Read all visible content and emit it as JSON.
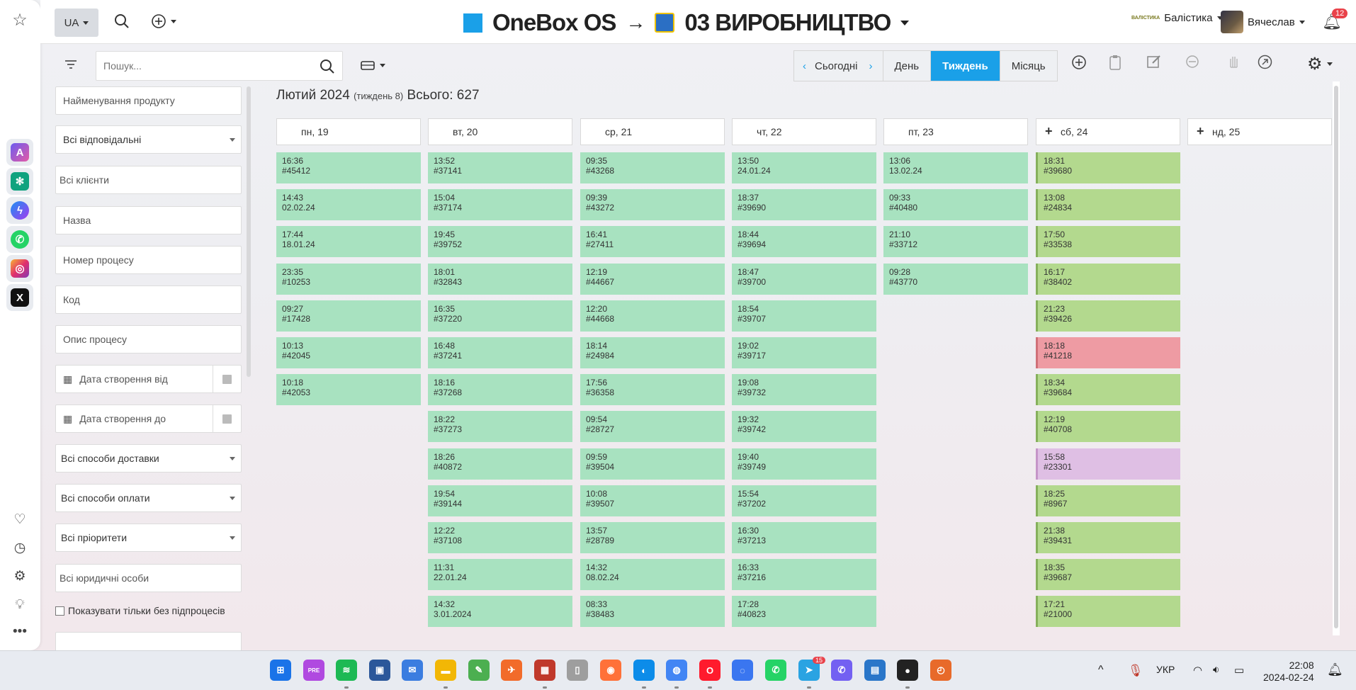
{
  "header": {
    "lang": "UA",
    "brand": "OneBox OS",
    "arrow": "→",
    "project": "03 ВИРОБНИЦТВО",
    "company": "Балістика",
    "company_logo_text": "ВАЛІСТИКА",
    "user": "Вячеслав",
    "notifications": "12"
  },
  "toolbar": {
    "search_placeholder": "Пошук...",
    "nav": {
      "prev": "‹",
      "today": "Сьогодні",
      "next": "›",
      "day": "День",
      "week": "Тиждень",
      "month": "Місяць"
    }
  },
  "filters": {
    "product_name": "Найменування продукту",
    "responsible": "Всі відповідальні",
    "clients": "Всі клієнти",
    "name": "Назва",
    "process_number": "Номер процесу",
    "code": "Код",
    "process_desc": "Опис процесу",
    "date_from": "Дата створення від",
    "date_to": "Дата створення до",
    "delivery": "Всі способи доставки",
    "payment": "Всі способи оплати",
    "priorities": "Всі пріоритети",
    "legal_entities": "Всі юридичні особи",
    "no_subprocess": "Показувати тільки без підпроцесів"
  },
  "calendar": {
    "month": "Лютий 2024",
    "week_label": "(тиждень 8)",
    "total": "Всього: 627",
    "days": [
      {
        "label": "пн, 19",
        "plus": false,
        "events": [
          {
            "t": "16:36",
            "n": "#45412",
            "c": "green"
          },
          {
            "t": "14:43",
            "n": "02.02.24",
            "c": "green"
          },
          {
            "t": "17:44",
            "n": "18.01.24",
            "c": "green"
          },
          {
            "t": "23:35",
            "n": "#10253",
            "c": "green"
          },
          {
            "t": "09:27",
            "n": "#17428",
            "c": "green"
          },
          {
            "t": "10:13",
            "n": "#42045",
            "c": "green"
          },
          {
            "t": "10:18",
            "n": "#42053",
            "c": "green"
          }
        ]
      },
      {
        "label": "вт, 20",
        "plus": false,
        "events": [
          {
            "t": "13:52",
            "n": "#37141",
            "c": "green"
          },
          {
            "t": "15:04",
            "n": "#37174",
            "c": "green"
          },
          {
            "t": "19:45",
            "n": "#39752",
            "c": "green"
          },
          {
            "t": "18:01",
            "n": "#32843",
            "c": "green"
          },
          {
            "t": "16:35",
            "n": "#37220",
            "c": "green"
          },
          {
            "t": "16:48",
            "n": "#37241",
            "c": "green"
          },
          {
            "t": "18:16",
            "n": "#37268",
            "c": "green"
          },
          {
            "t": "18:22",
            "n": "#37273",
            "c": "green"
          },
          {
            "t": "18:26",
            "n": "#40872",
            "c": "green"
          },
          {
            "t": "19:54",
            "n": "#39144",
            "c": "green"
          },
          {
            "t": "12:22",
            "n": "#37108",
            "c": "green"
          },
          {
            "t": "11:31",
            "n": "22.01.24",
            "c": "green"
          },
          {
            "t": "14:32",
            "n": "3.01.2024",
            "c": "green"
          }
        ]
      },
      {
        "label": "ср, 21",
        "plus": false,
        "events": [
          {
            "t": "09:35",
            "n": "#43268",
            "c": "green"
          },
          {
            "t": "09:39",
            "n": "#43272",
            "c": "green"
          },
          {
            "t": "16:41",
            "n": "#27411",
            "c": "green"
          },
          {
            "t": "12:19",
            "n": "#44667",
            "c": "green"
          },
          {
            "t": "12:20",
            "n": "#44668",
            "c": "green"
          },
          {
            "t": "18:14",
            "n": "#24984",
            "c": "green"
          },
          {
            "t": "17:56",
            "n": "#36358",
            "c": "green"
          },
          {
            "t": "09:54",
            "n": "#28727",
            "c": "green"
          },
          {
            "t": "09:59",
            "n": "#39504",
            "c": "green"
          },
          {
            "t": "10:08",
            "n": "#39507",
            "c": "green"
          },
          {
            "t": "13:57",
            "n": "#28789",
            "c": "green"
          },
          {
            "t": "14:32",
            "n": "08.02.24",
            "c": "green"
          },
          {
            "t": "08:33",
            "n": "#38483",
            "c": "green"
          }
        ]
      },
      {
        "label": "чт, 22",
        "plus": false,
        "events": [
          {
            "t": "13:50",
            "n": "24.01.24",
            "c": "green"
          },
          {
            "t": "18:37",
            "n": "#39690",
            "c": "green"
          },
          {
            "t": "18:44",
            "n": "#39694",
            "c": "green"
          },
          {
            "t": "18:47",
            "n": "#39700",
            "c": "green"
          },
          {
            "t": "18:54",
            "n": "#39707",
            "c": "green"
          },
          {
            "t": "19:02",
            "n": "#39717",
            "c": "green"
          },
          {
            "t": "19:08",
            "n": "#39732",
            "c": "green"
          },
          {
            "t": "19:32",
            "n": "#39742",
            "c": "green"
          },
          {
            "t": "19:40",
            "n": "#39749",
            "c": "green"
          },
          {
            "t": "15:54",
            "n": "#37202",
            "c": "green"
          },
          {
            "t": "16:30",
            "n": "#37213",
            "c": "green"
          },
          {
            "t": "16:33",
            "n": "#37216",
            "c": "green"
          },
          {
            "t": "17:28",
            "n": "#40823",
            "c": "green"
          }
        ]
      },
      {
        "label": "пт, 23",
        "plus": false,
        "events": [
          {
            "t": "13:06",
            "n": "13.02.24",
            "c": "green"
          },
          {
            "t": "09:33",
            "n": "#40480",
            "c": "green"
          },
          {
            "t": "21:10",
            "n": "#33712",
            "c": "green"
          },
          {
            "t": "09:28",
            "n": "#43770",
            "c": "green"
          }
        ]
      },
      {
        "label": "сб, 24",
        "plus": true,
        "events": [
          {
            "t": "18:31",
            "n": "#39680",
            "c": "olive"
          },
          {
            "t": "13:08",
            "n": "#24834",
            "c": "olive"
          },
          {
            "t": "17:50",
            "n": "#33538",
            "c": "olive"
          },
          {
            "t": "16:17",
            "n": "#38402",
            "c": "olive"
          },
          {
            "t": "21:23",
            "n": "#39426",
            "c": "olive"
          },
          {
            "t": "18:18",
            "n": "#41218",
            "c": "red"
          },
          {
            "t": "18:34",
            "n": "#39684",
            "c": "olive"
          },
          {
            "t": "12:19",
            "n": "#40708",
            "c": "olive"
          },
          {
            "t": "15:58",
            "n": "#23301",
            "c": "purple"
          },
          {
            "t": "18:25",
            "n": "#8967",
            "c": "olive"
          },
          {
            "t": "21:38",
            "n": "#39431",
            "c": "olive"
          },
          {
            "t": "18:35",
            "n": "#39687",
            "c": "olive"
          },
          {
            "t": "17:21",
            "n": "#21000",
            "c": "olive"
          }
        ]
      },
      {
        "label": "нд, 25",
        "plus": true,
        "events": []
      }
    ]
  },
  "taskbar": {
    "apps": [
      "windows-start",
      "copilot-pre",
      "spotify",
      "store",
      "mail",
      "explorer",
      "notes",
      "spark",
      "todoist",
      "files",
      "firefox",
      "edge",
      "chrome",
      "opera",
      "signal",
      "whatsapp",
      "telegram",
      "viber",
      "storage",
      "obs",
      "clock-app"
    ],
    "telegram_badge": "15",
    "language": "УКР",
    "time": "22:08",
    "date": "2024-02-24"
  },
  "colors": {
    "accent": "#1aa0e8",
    "event_green": "#a8e2c0",
    "event_olive": "#b3d98e",
    "event_red": "#ee9ba3",
    "event_purple": "#dfbfe4"
  }
}
